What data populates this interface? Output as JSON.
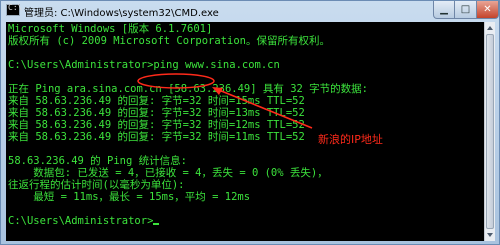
{
  "window": {
    "title": "管理员: C:\\Windows\\system32\\CMD.exe",
    "icon": "cmd-icon",
    "controls": {
      "minimize": "minimize-icon",
      "maximize": "maximize-icon",
      "close": "close-icon"
    },
    "colors": {
      "console_bg": "#000000",
      "console_text": "#3ce33c",
      "annotation": "#ff2a1a"
    }
  },
  "console": {
    "lines": [
      "Microsoft Windows [版本 6.1.7601]",
      "版权所有 (c) 2009 Microsoft Corporation。保留所有权利。",
      "",
      "C:\\Users\\Administrator>ping www.sina.com.cn",
      "",
      "正在 Ping ara.sina.com.cn [58.63.236.49] 具有 32 字节的数据:",
      "来自 58.63.236.49 的回复: 字节=32 时间=15ms TTL=52",
      "来自 58.63.236.49 的回复: 字节=32 时间=13ms TTL=52",
      "来自 58.63.236.49 的回复: 字节=32 时间=12ms TTL=52",
      "来自 58.63.236.49 的回复: 字节=32 时间=11ms TTL=52",
      "",
      "58.63.236.49 的 Ping 统计信息:",
      "    数据包: 已发送 = 4，已接收 = 4，丢失 = 0 (0% 丢失)，",
      "往返行程的估计时间(以毫秒为单位):",
      "    最短 = 11ms，最长 = 15ms，平均 = 12ms",
      "",
      "C:\\Users\\Administrator>"
    ]
  },
  "annotation": {
    "label": "新浪的IP地址"
  }
}
